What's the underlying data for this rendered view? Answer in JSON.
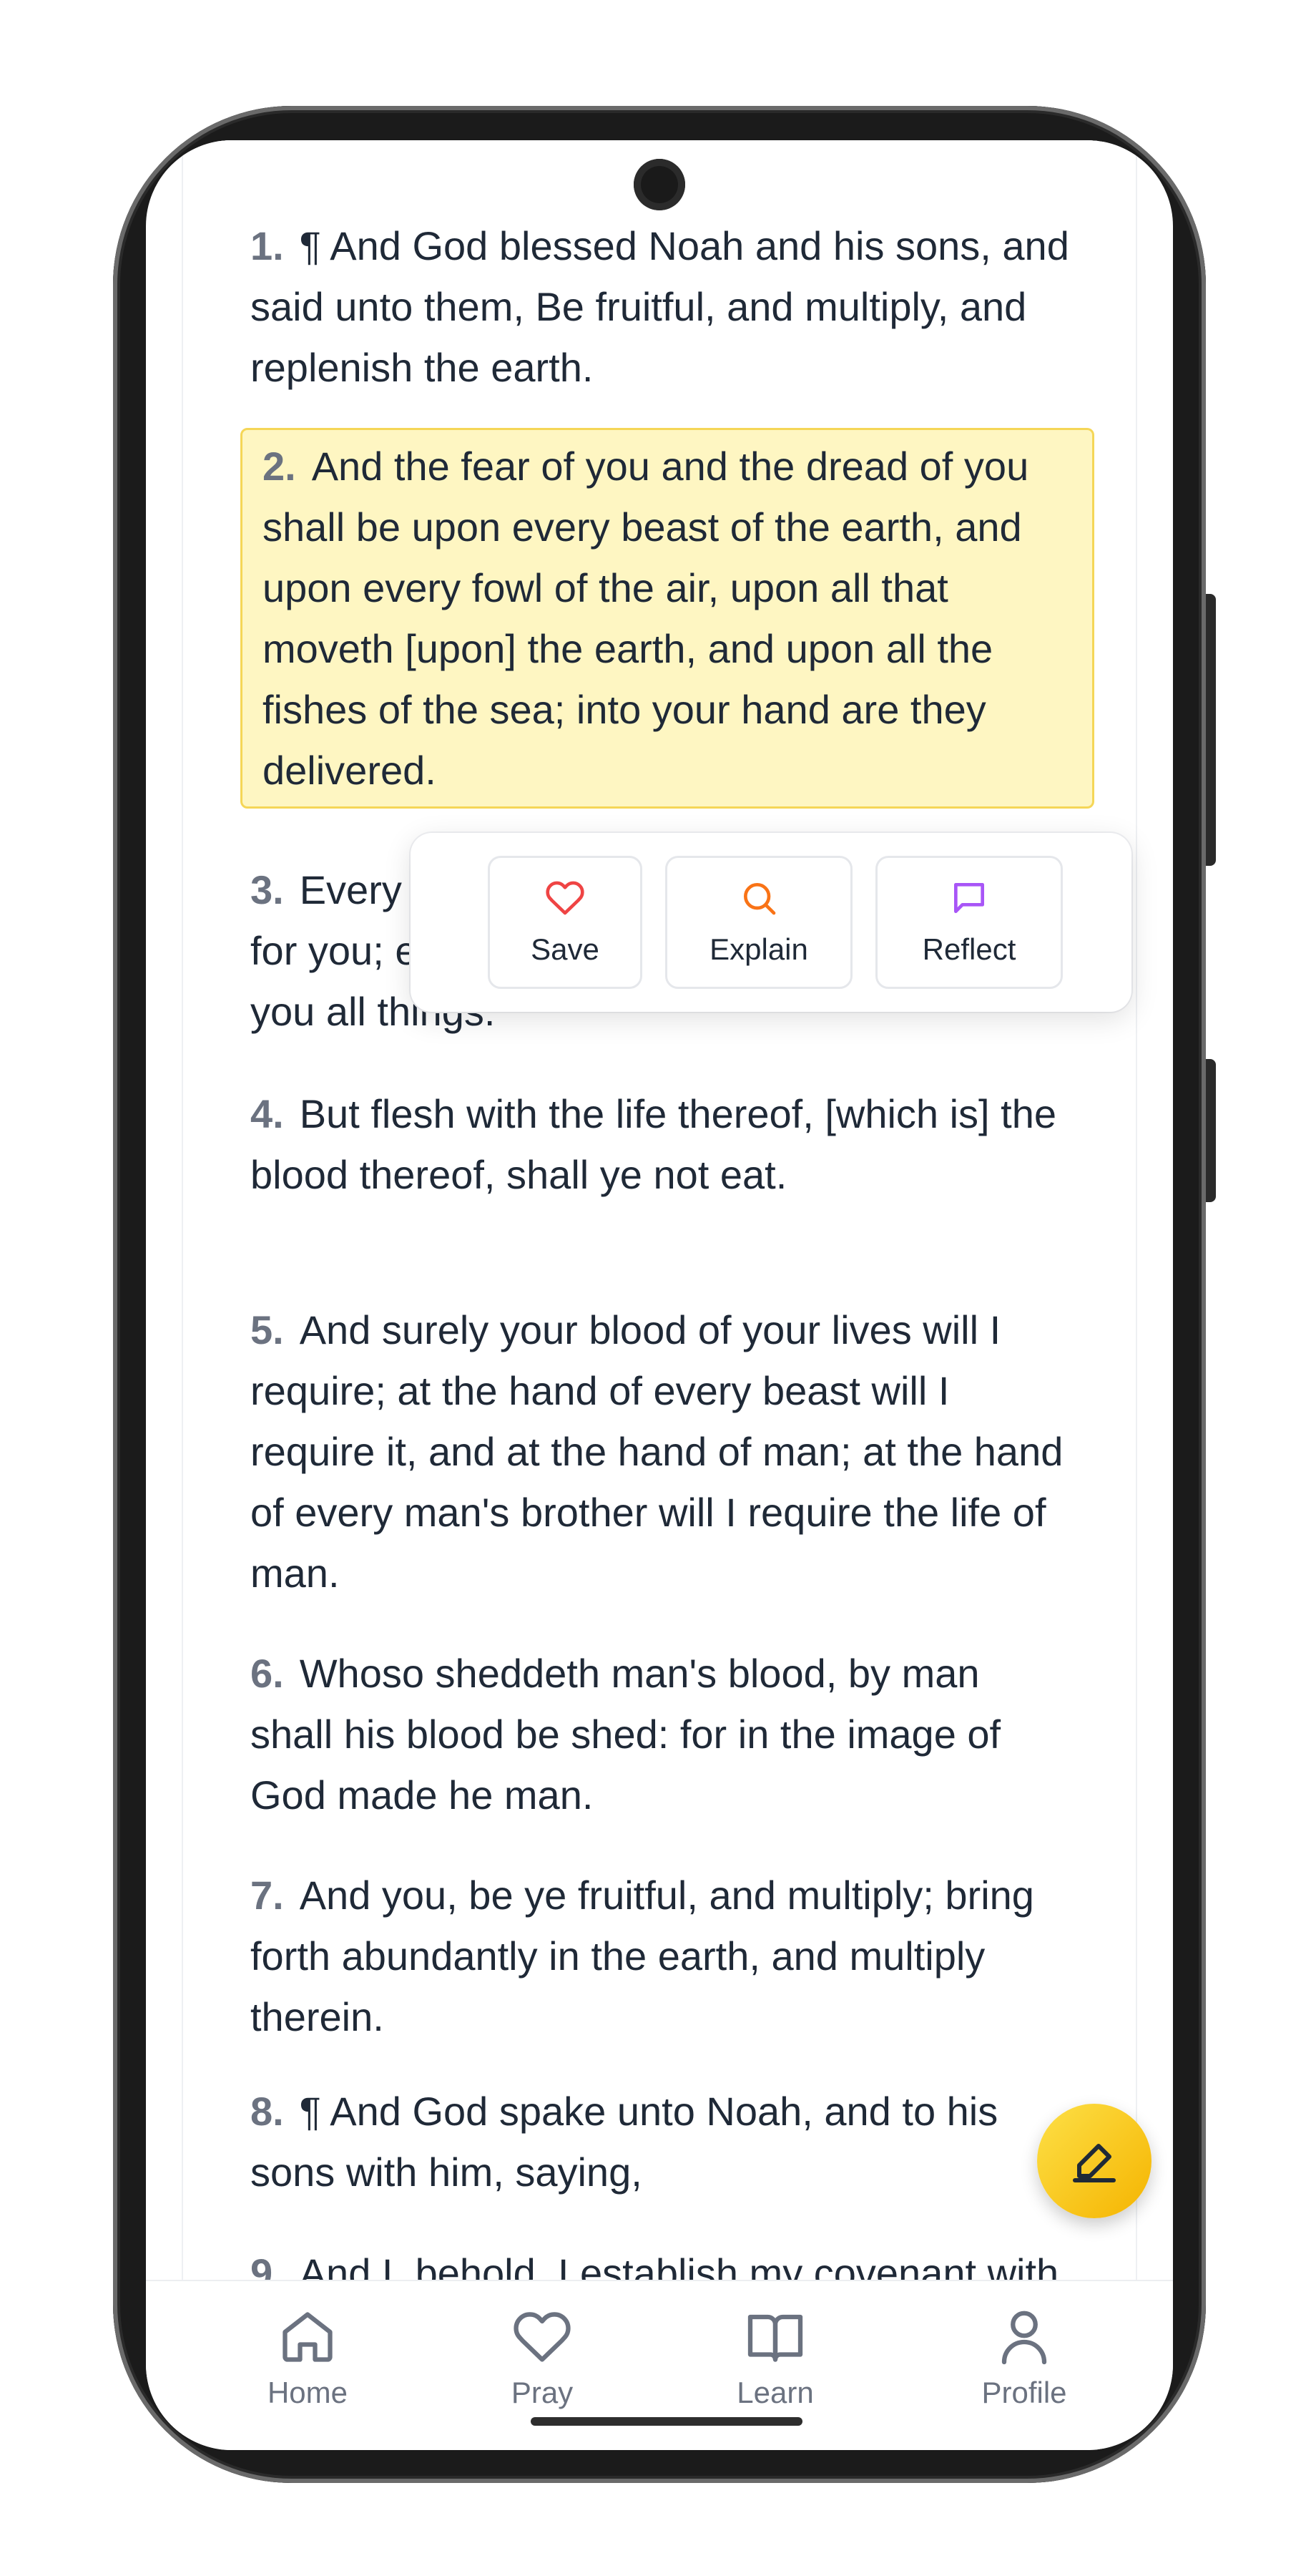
{
  "verses": [
    {
      "num": "1.",
      "text": "¶ And God blessed Noah and his sons, and said unto them, Be fruitful, and multiply, and replenish the earth."
    },
    {
      "num": "2.",
      "text": "And the fear of you and the dread of you shall be upon every beast of the earth, and upon every fowl of the air, upon all that moveth [upon] the earth, and upon all the fishes of the sea; into your hand are they delivered."
    },
    {
      "num": "3.",
      "text": "Every moving thing that liveth shall be meat for you; even as the green herb have I given you all things."
    },
    {
      "num": "4.",
      "text": "But flesh with the life thereof, [which is] the blood thereof, shall ye not eat."
    },
    {
      "num": "5.",
      "text": "And surely your blood of your lives will I require; at the hand of every beast will I require it, and at the hand of man; at the hand of every man's brother will I require the life of man."
    },
    {
      "num": "6.",
      "text": "Whoso sheddeth man's blood, by man shall his blood be shed: for in the image of God made he man."
    },
    {
      "num": "7.",
      "text": "And you, be ye fruitful, and multiply; bring forth abundantly in the earth, and multiply therein."
    },
    {
      "num": "8.",
      "text": "¶ And God spake unto Noah, and to his sons with him, saying,"
    },
    {
      "num": "9.",
      "text": "And I, behold, I establish my covenant with you, and with your seed after you;"
    }
  ],
  "actions": {
    "save": {
      "label": "Save",
      "icon": "heart-icon",
      "color": "#ef4444"
    },
    "explain": {
      "label": "Explain",
      "icon": "search-icon",
      "color": "#f97316"
    },
    "reflect": {
      "label": "Reflect",
      "icon": "message-icon",
      "color": "#a855f7"
    }
  },
  "fab": {
    "icon": "pen-icon",
    "color": "#facc15"
  },
  "nav": {
    "home": "Home",
    "pray": "Pray",
    "learn": "Learn",
    "profile": "Profile"
  }
}
